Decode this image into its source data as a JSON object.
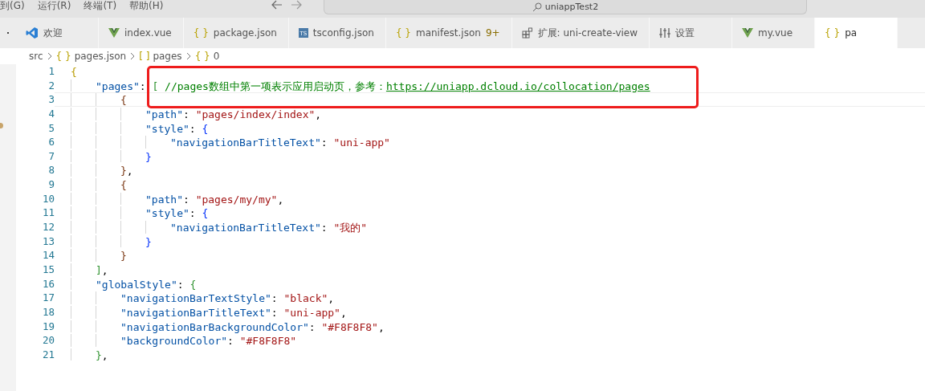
{
  "menu": [
    "到(G)",
    "运行(R)",
    "终端(T)",
    "帮助(H)"
  ],
  "search": {
    "value": "uniappTest2"
  },
  "tabs": [
    {
      "label": "欢迎",
      "icon": {
        "kind": "vscode"
      },
      "selected": false
    },
    {
      "label": "index.vue",
      "icon": {
        "kind": "vue"
      },
      "selected": false
    },
    {
      "label": "package.json",
      "icon": {
        "kind": "glyph",
        "text": "{ }"
      },
      "selected": false
    },
    {
      "label": "tsconfig.json",
      "icon": {
        "kind": "ts",
        "text": "TS"
      },
      "selected": false
    },
    {
      "label": "manifest.json",
      "icon": {
        "kind": "glyph",
        "text": "{ }"
      },
      "badge": "9+",
      "selected": false
    },
    {
      "label": "扩展: uni-create-view",
      "icon": {
        "kind": "extension"
      },
      "selected": false
    },
    {
      "label": "设置",
      "icon": {
        "kind": "settings"
      },
      "selected": false
    },
    {
      "label": "my.vue",
      "icon": {
        "kind": "vue"
      },
      "selected": false
    },
    {
      "label": "pa",
      "icon": {
        "kind": "glyph",
        "text": "{ }"
      },
      "selected": true
    }
  ],
  "breadcrumb": [
    {
      "label": "src"
    },
    {
      "icon": "{ }",
      "label": "pages.json"
    },
    {
      "icon": "[ ]",
      "label": "pages"
    },
    {
      "icon": "{ }",
      "label": "0"
    }
  ],
  "lines": [
    {
      "n": "1",
      "tokens": [
        {
          "kind": "open",
          "text": "{"
        }
      ],
      "children": [
        {
          "n": "2",
          "tokens": [
            {
              "kind": "key",
              "text": "\"pages\""
            },
            {
              "kind": "punct",
              "text": ": "
            },
            {
              "kind": "open",
              "text": "["
            },
            {
              "kind": "comment",
              "text": " //pages数组中第一项表示应用启动页，参考："
            },
            {
              "kind": "link",
              "text": "https://uniapp.dcloud.io/collocation/pages"
            }
          ],
          "children": [
            {
              "n": "3",
              "current": true,
              "tokens": [
                {
                  "kind": "open",
                  "text": "{"
                }
              ],
              "children": [
                {
                  "n": "4",
                  "tokens": [
                    {
                      "kind": "key",
                      "text": "\"path\""
                    },
                    {
                      "kind": "punct",
                      "text": ": "
                    },
                    {
                      "kind": "string",
                      "text": "\"pages/index/index\""
                    },
                    {
                      "kind": "punct",
                      "text": ","
                    }
                  ]
                },
                {
                  "n": "5",
                  "tokens": [
                    {
                      "kind": "key",
                      "text": "\"style\""
                    },
                    {
                      "kind": "punct",
                      "text": ": "
                    },
                    {
                      "kind": "open",
                      "text": "{"
                    }
                  ],
                  "children": [
                    {
                      "n": "6",
                      "tokens": [
                        {
                          "kind": "key",
                          "text": "\"navigationBarTitleText\""
                        },
                        {
                          "kind": "punct",
                          "text": ": "
                        },
                        {
                          "kind": "string",
                          "text": "\"uni-app\""
                        }
                      ]
                    }
                  ]
                },
                {
                  "n": "7",
                  "tokens": [
                    {
                      "kind": "close",
                      "text": "}"
                    }
                  ]
                }
              ]
            },
            {
              "n": "8",
              "tokens": [
                {
                  "kind": "close",
                  "text": "}"
                },
                {
                  "kind": "punct",
                  "text": ","
                }
              ]
            },
            {
              "n": "9",
              "tokens": [
                {
                  "kind": "open",
                  "text": "{"
                }
              ],
              "children": [
                {
                  "n": "10",
                  "tokens": [
                    {
                      "kind": "key",
                      "text": "\"path\""
                    },
                    {
                      "kind": "punct",
                      "text": ": "
                    },
                    {
                      "kind": "string",
                      "text": "\"pages/my/my\""
                    },
                    {
                      "kind": "punct",
                      "text": ","
                    }
                  ]
                },
                {
                  "n": "11",
                  "tokens": [
                    {
                      "kind": "key",
                      "text": "\"style\""
                    },
                    {
                      "kind": "punct",
                      "text": ": "
                    },
                    {
                      "kind": "open",
                      "text": "{"
                    }
                  ],
                  "children": [
                    {
                      "n": "12",
                      "tokens": [
                        {
                          "kind": "key",
                          "text": "\"navigationBarTitleText\""
                        },
                        {
                          "kind": "punct",
                          "text": ": "
                        },
                        {
                          "kind": "string",
                          "text": "\"我的\""
                        }
                      ]
                    }
                  ]
                },
                {
                  "n": "13",
                  "tokens": [
                    {
                      "kind": "close",
                      "text": "}"
                    }
                  ]
                }
              ]
            },
            {
              "n": "14",
              "tokens": [
                {
                  "kind": "close",
                  "text": "}"
                }
              ]
            }
          ]
        },
        {
          "n": "15",
          "tokens": [
            {
              "kind": "close",
              "text": "]"
            },
            {
              "kind": "punct",
              "text": ","
            }
          ]
        },
        {
          "n": "16",
          "tokens": [
            {
              "kind": "key",
              "text": "\"globalStyle\""
            },
            {
              "kind": "punct",
              "text": ": "
            },
            {
              "kind": "open",
              "text": "{"
            }
          ],
          "children": [
            {
              "n": "17",
              "tokens": [
                {
                  "kind": "key",
                  "text": "\"navigationBarTextStyle\""
                },
                {
                  "kind": "punct",
                  "text": ": "
                },
                {
                  "kind": "string",
                  "text": "\"black\""
                },
                {
                  "kind": "punct",
                  "text": ","
                }
              ]
            },
            {
              "n": "18",
              "tokens": [
                {
                  "kind": "key",
                  "text": "\"navigationBarTitleText\""
                },
                {
                  "kind": "punct",
                  "text": ": "
                },
                {
                  "kind": "string",
                  "text": "\"uni-app\""
                },
                {
                  "kind": "punct",
                  "text": ","
                }
              ]
            },
            {
              "n": "19",
              "tokens": [
                {
                  "kind": "key",
                  "text": "\"navigationBarBackgroundColor\""
                },
                {
                  "kind": "punct",
                  "text": ": "
                },
                {
                  "kind": "string",
                  "text": "\"#F8F8F8\""
                },
                {
                  "kind": "punct",
                  "text": ","
                }
              ]
            },
            {
              "n": "20",
              "tokens": [
                {
                  "kind": "key",
                  "text": "\"backgroundColor\""
                },
                {
                  "kind": "punct",
                  "text": ": "
                },
                {
                  "kind": "string",
                  "text": "\"#F8F8F8\""
                }
              ]
            }
          ]
        },
        {
          "n": "21",
          "tokens": [
            {
              "kind": "close",
              "text": "}"
            },
            {
              "kind": "punct",
              "text": ","
            }
          ]
        }
      ]
    }
  ],
  "annotation": {
    "kind": "frame"
  }
}
